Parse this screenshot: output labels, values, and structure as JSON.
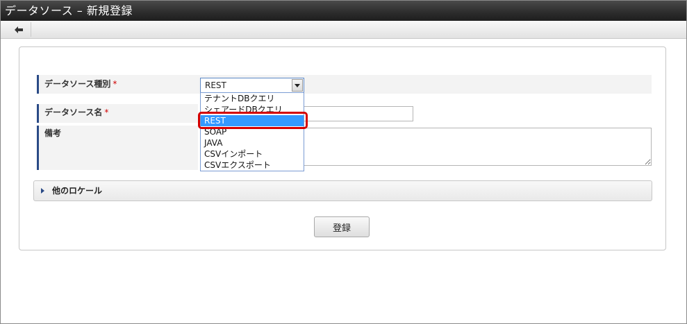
{
  "window": {
    "title": "データソース – 新規登録"
  },
  "toolbar": {
    "back_icon": "arrow-left-icon"
  },
  "form": {
    "fields": {
      "type": {
        "label": "データソース種別",
        "required_mark": "*",
        "selected_value": "REST"
      },
      "name": {
        "label": "データソース名",
        "required_mark": "*",
        "value": ""
      },
      "remarks": {
        "label": "備考",
        "value": ""
      }
    },
    "dropdown_options": [
      "テナントDBクエリ",
      "シェアードDBクエリ",
      "REST",
      "SOAP",
      "JAVA",
      "CSVインポート",
      "CSVエクスポート"
    ],
    "other_locale_label": "他のロケール",
    "submit_label": "登録"
  },
  "colors": {
    "label_bar": "#2a4a86",
    "required": "#d00000",
    "option_selected": "#3399ff",
    "highlight_box": "#d40000"
  }
}
